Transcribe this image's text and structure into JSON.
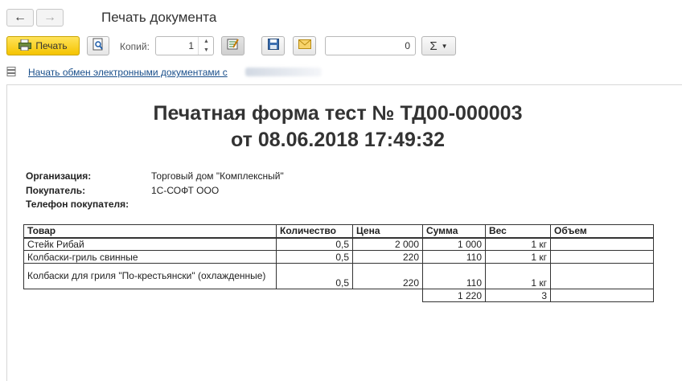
{
  "window": {
    "title": "Печать документа"
  },
  "toolbar": {
    "print_label": "Печать",
    "copies_label": "Копий:",
    "copies_value": "1",
    "counter_value": "0",
    "sum_symbol": "Σ"
  },
  "exchange_link": "Начать обмен электронными документами с",
  "document": {
    "title_line1": "Печатная форма тест № ТД00-000003",
    "title_line2": "от 08.06.2018 17:49:32",
    "org_label": "Организация:",
    "org_value": "Торговый дом \"Комплексный\"",
    "buyer_label": "Покупатель:",
    "buyer_value": "1С-СОФТ ООО",
    "phone_label": "Телефон покупателя:",
    "table": {
      "headers": [
        "Товар",
        "Количество",
        "Цена",
        "Сумма",
        "Вес",
        "Объем"
      ],
      "rows": [
        [
          "Стейк Рибай",
          "0,5",
          "2 000",
          "1 000",
          "1 кг",
          ""
        ],
        [
          "Колбаски-гриль свинные",
          "0,5",
          "220",
          "110",
          "1 кг",
          ""
        ],
        [
          "Колбаски для гриля \"По-крестьянски\" (охлажденные)",
          "0,5",
          "220",
          "110",
          "1 кг",
          ""
        ]
      ],
      "totals": {
        "sum": "1 220",
        "weight": "3",
        "volume": ""
      }
    }
  },
  "icons": {
    "back": "←",
    "forward": "→",
    "save": "floppy-disk",
    "mail": "envelope"
  }
}
